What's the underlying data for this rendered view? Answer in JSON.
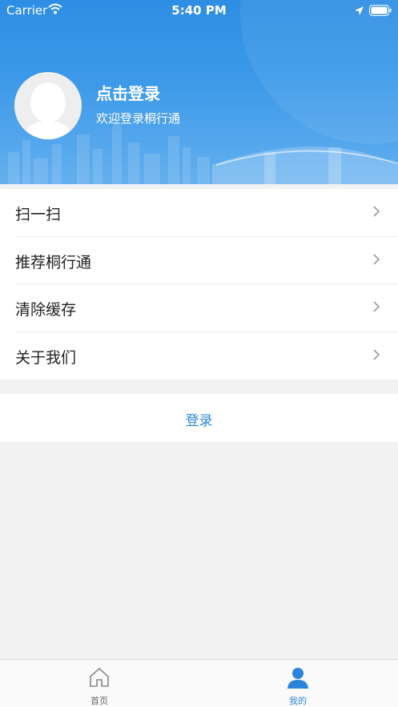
{
  "status_bar": {
    "carrier": "Carrier",
    "time": "5:40 PM"
  },
  "profile": {
    "title": "点击登录",
    "subtitle": "欢迎登录桐行通"
  },
  "menu": {
    "items": [
      {
        "label": "扫一扫",
        "icon": "chevron-right-icon"
      },
      {
        "label": "推荐桐行通",
        "icon": "chevron-right-icon"
      },
      {
        "label": "清除缓存",
        "icon": "chevron-right-icon"
      },
      {
        "label": "关于我们",
        "icon": "chevron-right-icon"
      }
    ]
  },
  "login_button": {
    "label": "登录"
  },
  "tabbar": {
    "tabs": [
      {
        "label": "首页",
        "icon": "home-icon",
        "active": false
      },
      {
        "label": "我的",
        "icon": "person-icon",
        "active": true
      }
    ]
  },
  "colors": {
    "header": "#3d9ae9",
    "accent": "#2b86d9",
    "inactive": "#666666"
  }
}
